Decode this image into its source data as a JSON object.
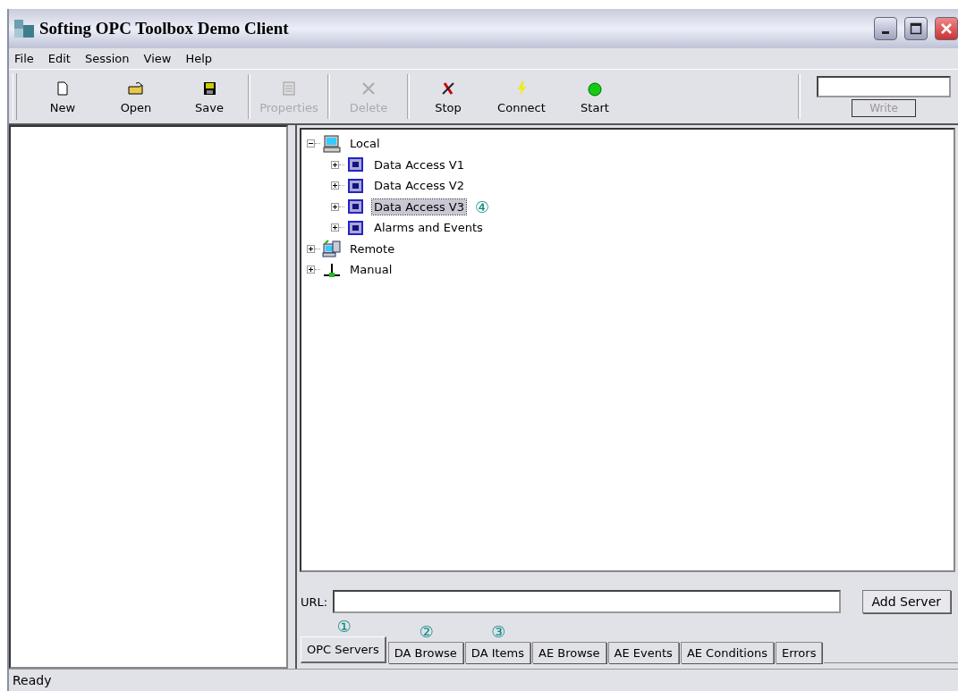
{
  "window": {
    "title": "Softing OPC Toolbox Demo Client"
  },
  "menu": [
    "File",
    "Edit",
    "Session",
    "View",
    "Help"
  ],
  "toolbar": [
    {
      "label": "New",
      "disabled": false
    },
    {
      "label": "Open",
      "disabled": false
    },
    {
      "label": "Save",
      "disabled": false
    },
    {
      "label": "Properties",
      "disabled": true
    },
    {
      "label": "Delete",
      "disabled": true
    },
    {
      "label": "Stop",
      "disabled": false
    },
    {
      "label": "Connect",
      "disabled": false
    },
    {
      "label": "Start",
      "disabled": false
    }
  ],
  "write": {
    "button": "Write",
    "disabled": true
  },
  "tree": [
    {
      "label": "Local",
      "kind": "computer",
      "expanded": true,
      "selected": false,
      "children": [
        {
          "label": "Data Access V1",
          "kind": "server",
          "expanded": false,
          "selected": false
        },
        {
          "label": "Data Access V2",
          "kind": "server",
          "expanded": false,
          "selected": false
        },
        {
          "label": "Data Access V3",
          "kind": "server",
          "expanded": false,
          "selected": true,
          "callout": "④"
        },
        {
          "label": "Alarms and Events",
          "kind": "server",
          "expanded": false,
          "selected": false
        }
      ]
    },
    {
      "label": "Remote",
      "kind": "network",
      "expanded": false,
      "selected": false
    },
    {
      "label": "Manual",
      "kind": "manual",
      "expanded": false,
      "selected": false
    }
  ],
  "url": {
    "label": "URL:",
    "button": "Add Server"
  },
  "tabs": [
    {
      "label": "OPC Servers",
      "selected": true,
      "callout": "①"
    },
    {
      "label": "DA Browse",
      "selected": false,
      "callout": "②"
    },
    {
      "label": "DA Items",
      "selected": false,
      "callout": "③"
    },
    {
      "label": "AE Browse",
      "selected": false
    },
    {
      "label": "AE Events",
      "selected": false
    },
    {
      "label": "AE Conditions",
      "selected": false
    },
    {
      "label": "Errors",
      "selected": false
    }
  ],
  "status_bar": "Ready"
}
